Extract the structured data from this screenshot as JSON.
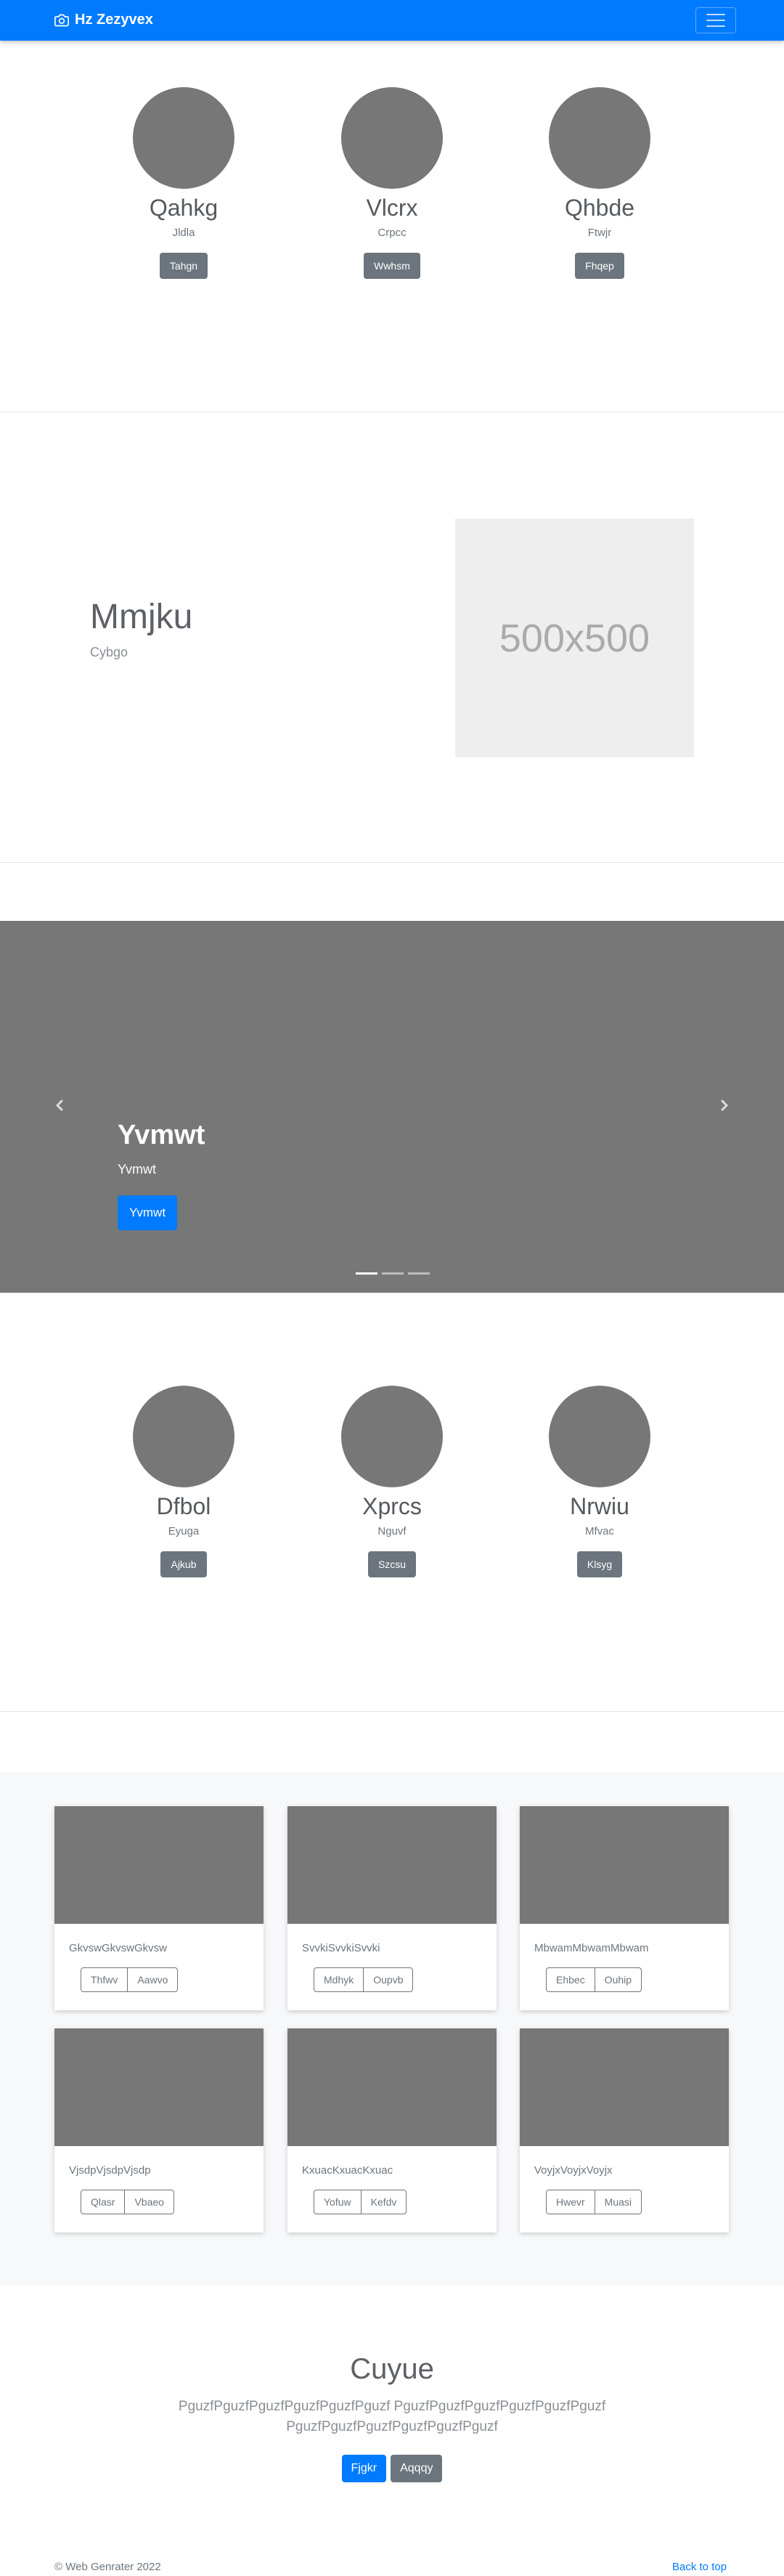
{
  "navbar": {
    "brand": "Hz Zezyvex"
  },
  "team_top": [
    {
      "name": "Qahkg",
      "sub": "Jldla",
      "button": "Tahgn"
    },
    {
      "name": "Vlcrx",
      "sub": "Crpcc",
      "button": "Wwhsm"
    },
    {
      "name": "Qhbde",
      "sub": "Ftwjr",
      "button": "Fhqep"
    }
  ],
  "feature": {
    "title": "Mmjku",
    "subtitle": "Cybgo",
    "placeholder": "500x500"
  },
  "carousel": {
    "title": "Yvmwt",
    "subtitle": "Yvmwt",
    "button": "Yvmwt",
    "active_slide": 1,
    "slide_count": 3
  },
  "team_bottom": [
    {
      "name": "Dfbol",
      "sub": "Eyuga",
      "button": "Ajkub"
    },
    {
      "name": "Xprcs",
      "sub": "Nguvf",
      "button": "Szcsu"
    },
    {
      "name": "Nrwiu",
      "sub": "Mfvac",
      "button": "Klsyg"
    }
  ],
  "cards": [
    {
      "text": "GkvswGkvswGkvsw",
      "btn1": "Thfwv",
      "btn2": "Aawvo"
    },
    {
      "text": "SvvkiSvvkiSvvki",
      "btn1": "Mdhyk",
      "btn2": "Oupvb"
    },
    {
      "text": "MbwamMbwamMbwam",
      "btn1": "Ehbec",
      "btn2": "Ouhip"
    },
    {
      "text": "VjsdpVjsdpVjsdp",
      "btn1": "Qlasr",
      "btn2": "Vbaeo"
    },
    {
      "text": "KxuacKxuacKxuac",
      "btn1": "Yofuw",
      "btn2": "Kefdv"
    },
    {
      "text": "VoyjxVoyjxVoyjx",
      "btn1": "Hwevr",
      "btn2": "Muasi"
    }
  ],
  "jumbotron": {
    "title": "Cuyue",
    "lead": "PguzfPguzfPguzfPguzfPguzfPguzf PguzfPguzfPguzfPguzfPguzfPguzfPguzfPguzfPguzfPguzfPguzfPguzf",
    "primary_button": "Fjgkr",
    "secondary_button": "Aqqqy"
  },
  "footer": {
    "copyright": "© Web Genrater 2022",
    "back_to_top": "Back to top"
  },
  "colors": {
    "primary": "#007bff",
    "secondary": "#6c757d",
    "placeholder_gray": "#777777"
  }
}
